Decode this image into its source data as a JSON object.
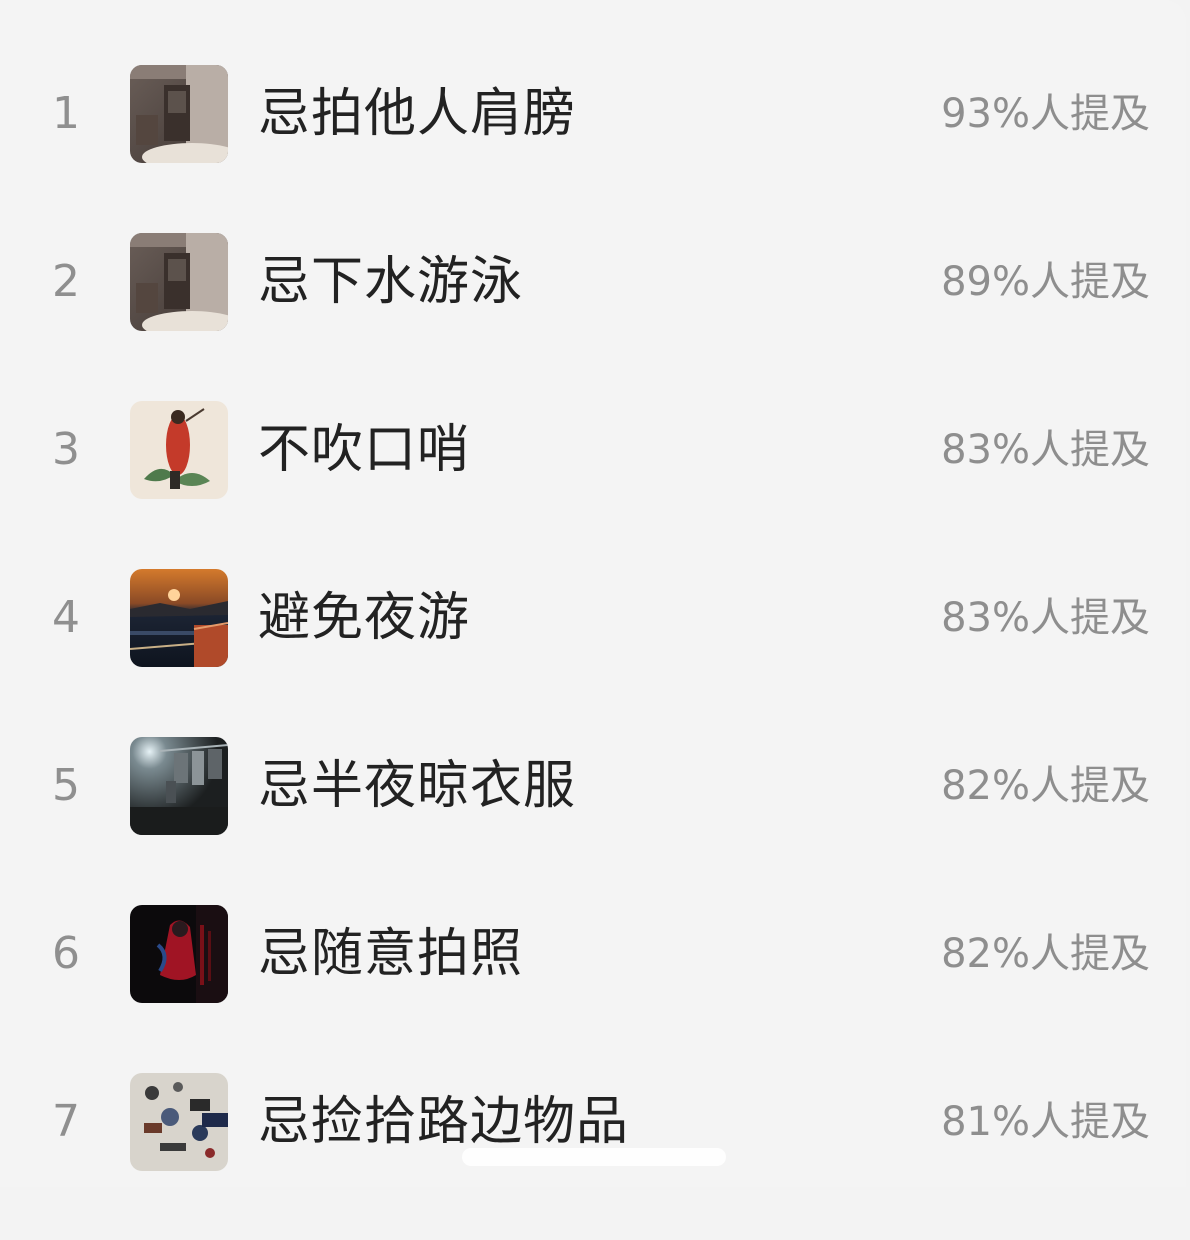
{
  "ranking": {
    "items": [
      {
        "rank": "1",
        "title": "忌拍他人肩膀",
        "stat": "93%人提及",
        "thumb": "dim-room-doorway-image"
      },
      {
        "rank": "2",
        "title": "忌下水游泳",
        "stat": "89%人提及",
        "thumb": "dim-room-doorway-image"
      },
      {
        "rank": "3",
        "title": "不吹口哨",
        "stat": "83%人提及",
        "thumb": "red-robed-figure-painting-image"
      },
      {
        "rank": "4",
        "title": "避免夜游",
        "stat": "83%人提及",
        "thumb": "night-lakeside-sunset-image"
      },
      {
        "rank": "5",
        "title": "忌半夜晾衣服",
        "stat": "82%人提及",
        "thumb": "clothes-drying-at-night-image"
      },
      {
        "rank": "6",
        "title": "忌随意拍照",
        "stat": "82%人提及",
        "thumb": "red-costume-figure-dark-image"
      },
      {
        "rank": "7",
        "title": "忌捡拾路边物品",
        "stat": "81%人提及",
        "thumb": "scattered-objects-image"
      }
    ]
  },
  "colors": {
    "background": "#f4f4f4",
    "title_text": "#222222",
    "muted_text": "#8e8e8e"
  }
}
